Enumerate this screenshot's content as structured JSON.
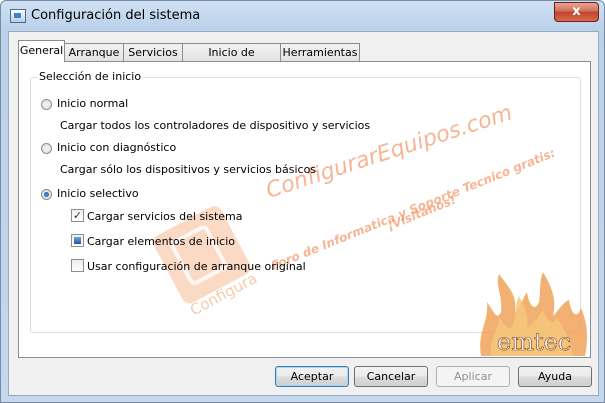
{
  "window": {
    "title": "Configuración del sistema",
    "close_glyph": "x"
  },
  "tabs": [
    {
      "label": "General",
      "active": true
    },
    {
      "label": "Arranque"
    },
    {
      "label": "Servicios"
    },
    {
      "label": "Inicio de Windows"
    },
    {
      "label": "Herramientas"
    }
  ],
  "startup": {
    "group_label": "Selección de inicio",
    "normal": {
      "label": "Inicio normal",
      "description": "Cargar todos los controladores de dispositivo y servicios",
      "selected": false
    },
    "diagnostic": {
      "label": "Inicio con diagnóstico",
      "description": "Cargar sólo los dispositivos y servicios básicos",
      "selected": false
    },
    "selective": {
      "label": "Inicio selectivo",
      "selected": true
    },
    "options": [
      {
        "label": "Cargar servicios del sistema",
        "state": "checked"
      },
      {
        "label": "Cargar elementos de inicio",
        "state": "indeterminate"
      },
      {
        "label": "Usar configuración de arranque original",
        "state": "unchecked"
      }
    ]
  },
  "watermark": {
    "line1": "ConfigurarEquipos.com",
    "line2": "Foro de Informatica y Soporte Tecnico gratis:",
    "line3": "¡Visitanos!",
    "badge": "emtec"
  },
  "buttons": {
    "ok": "Aceptar",
    "cancel": "Cancelar",
    "apply": "Aplicar",
    "help": "Ayuda"
  }
}
